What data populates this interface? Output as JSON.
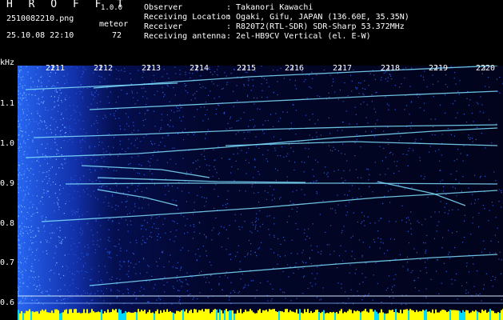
{
  "header": {
    "app_title": "H R O F F T",
    "version": "1.0.0",
    "file_name": "2510082210.png",
    "timestamp": "25.10.08 22:10",
    "mode": "meteor",
    "count": "72",
    "info": [
      {
        "label": "Observer",
        "value": ": Takanori Kawachi"
      },
      {
        "label": "Receiving Location",
        "value": ": Ogaki, Gifu, JAPAN (136.60E, 35.35N)"
      },
      {
        "label": "Receiver",
        "value": ": R820T2(RTL-SDR) SDR-Sharp 53.372MHz"
      },
      {
        "label": "Receiving antenna",
        "value": ": 2el-HB9CV Vertical (el. E-W)"
      }
    ]
  },
  "axis": {
    "unit": "kHz",
    "freq_ticks": [
      "1.1",
      "1.0",
      "0.9",
      "0.8",
      "0.7",
      "0.6"
    ],
    "time_ticks": [
      "2211",
      "2212",
      "2213",
      "2214",
      "2215",
      "2216",
      "2217",
      "2218",
      "2219",
      "2220"
    ]
  },
  "colors": {
    "background": "#000000",
    "noise": "#1a3cff",
    "trace": "#7fe0ff",
    "signal_peak": "#ffff00",
    "baseline": "#00d8ff"
  }
}
